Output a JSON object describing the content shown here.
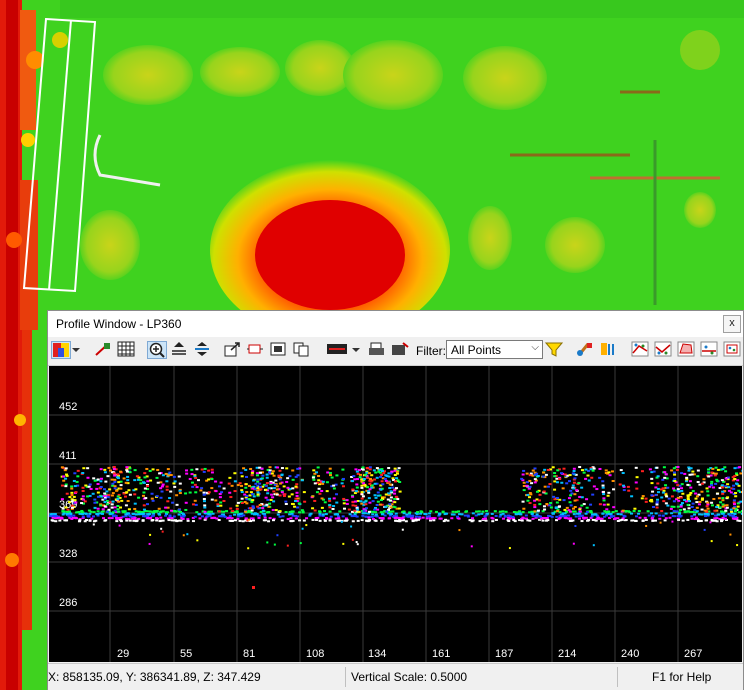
{
  "window": {
    "title": "Profile Window - LP360",
    "close_label": "x"
  },
  "toolbar": {
    "filter_label": "Filter:",
    "filter_value": "All Points"
  },
  "profile": {
    "y_ticks": [
      "452",
      "411",
      "369",
      "328",
      "286"
    ],
    "x_ticks": [
      "29",
      "55",
      "81",
      "108",
      "134",
      "161",
      "187",
      "214",
      "240",
      "267"
    ]
  },
  "status": {
    "coords": "X: 858135.09, Y: 386341.89, Z: 347.429",
    "vertical_scale": "Vertical Scale: 0.5000",
    "help": "F1 for Help"
  },
  "colors": {
    "background_green": "#3fd21f",
    "plot_background": "#000000",
    "grid": "#3a3a3a"
  }
}
